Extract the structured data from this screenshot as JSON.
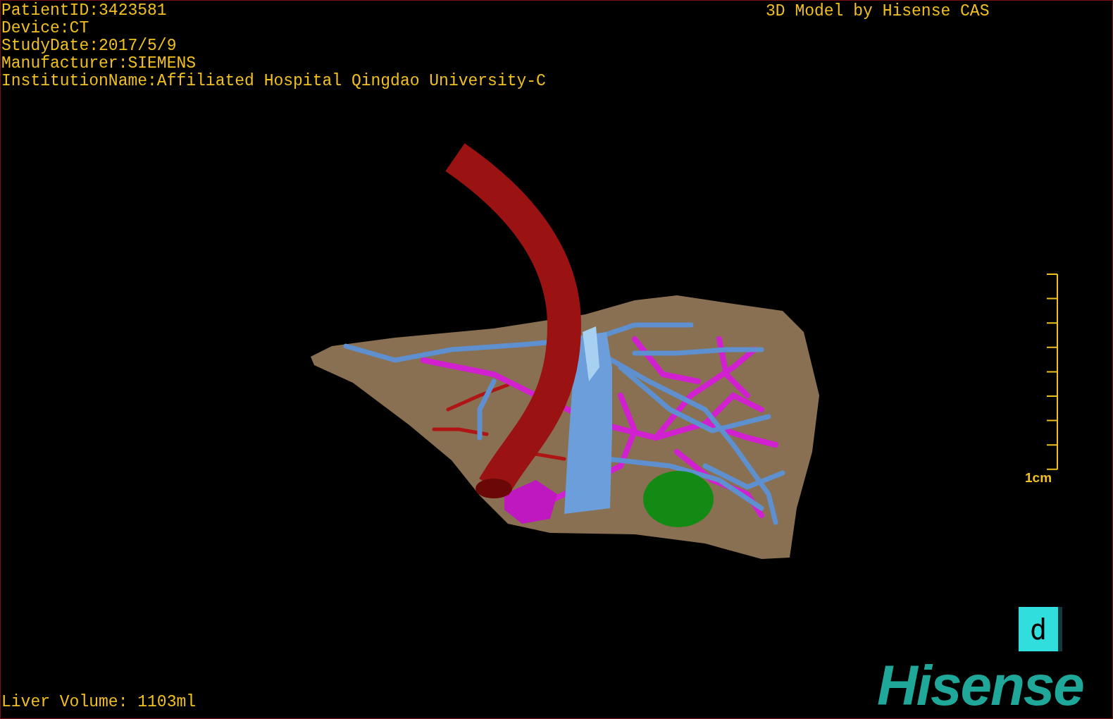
{
  "patient_info": [
    "PatientID:3423581",
    "Device:CT",
    "StudyDate:2017/5/9",
    "Manufacturer:SIEMENS",
    "InstitutionName:Affiliated Hospital Qingdao University-C"
  ],
  "model_credit": "3D Model by Hisense CAS",
  "scale_bar": {
    "label": "1cm"
  },
  "view_button": {
    "label": "d"
  },
  "liver_volume": "Liver Volume: 1103ml",
  "brand_logo": "Hisense"
}
